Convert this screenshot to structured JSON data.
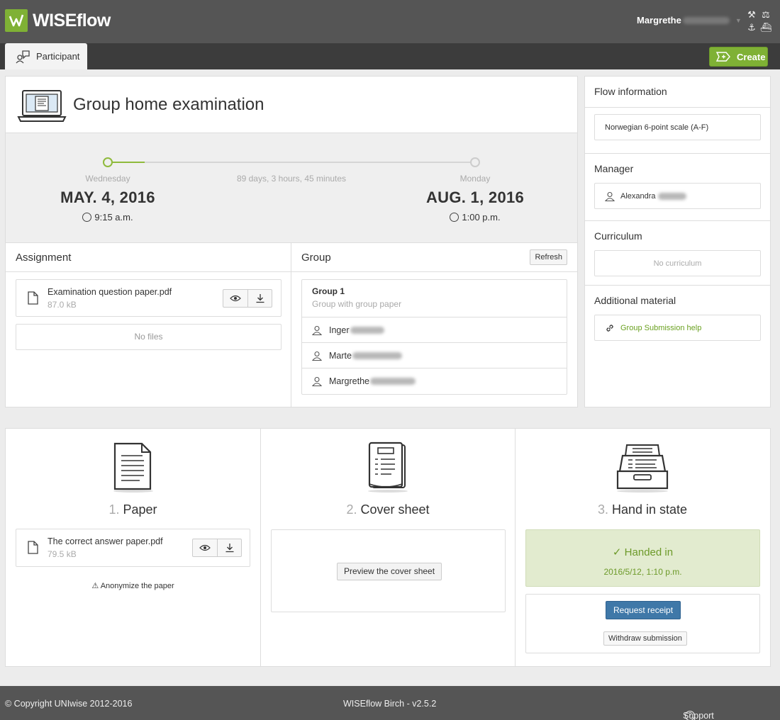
{
  "app": {
    "name": "WISEflow"
  },
  "header": {
    "user_first": "Margrethe",
    "tools_icons": [
      "hammer-icon",
      "scales-icon",
      "anchor-icon",
      "ship-icon"
    ]
  },
  "tabs": {
    "participant": "Participant",
    "create": "Create"
  },
  "exam": {
    "title": "Group home examination",
    "start": {
      "day": "Wednesday",
      "date": "MAY. 4, 2016",
      "time": "9:15 a.m."
    },
    "end": {
      "day": "Monday",
      "date": "AUG. 1, 2016",
      "time": "1:00 p.m."
    },
    "duration": "89 days, 3 hours, 45 minutes"
  },
  "assignment": {
    "heading": "Assignment",
    "file": {
      "name": "Examination question paper.pdf",
      "size": "87.0 kB"
    },
    "no_files": "No files"
  },
  "group": {
    "heading": "Group",
    "refresh": "Refresh",
    "name": "Group 1",
    "subtitle": "Group with group paper",
    "members": [
      "Inger",
      "Marte",
      "Margrethe"
    ]
  },
  "flow_info": {
    "heading": "Flow information",
    "grade_scale": "Norwegian 6-point scale (A-F)",
    "manager_heading": "Manager",
    "manager": "Alexandra",
    "curriculum_heading": "Curriculum",
    "curriculum": "No curriculum",
    "material_heading": "Additional material",
    "material_link": "Group Submission help"
  },
  "steps": {
    "paper": {
      "num": "1.",
      "title": "Paper",
      "file": {
        "name": "The correct answer paper.pdf",
        "size": "79.5 kB"
      },
      "anonymize": "Anonymize the paper"
    },
    "cover": {
      "num": "2.",
      "title": "Cover sheet",
      "preview": "Preview the cover sheet"
    },
    "handin": {
      "num": "3.",
      "title": "Hand in state",
      "status": "Handed in",
      "date": "2016/5/12, 1:10 p.m.",
      "request_receipt": "Request receipt",
      "withdraw": "Withdraw submission"
    }
  },
  "footer": {
    "copyright": "© Copyright UNIwise 2012-2016",
    "version": "WISEflow Birch - v2.5.2",
    "support": "Support & Feedback"
  },
  "colors": {
    "brand": "#7fb135",
    "header": "#555555",
    "primary_button": "#3f78a8",
    "success_bg": "#e2ebcf"
  }
}
